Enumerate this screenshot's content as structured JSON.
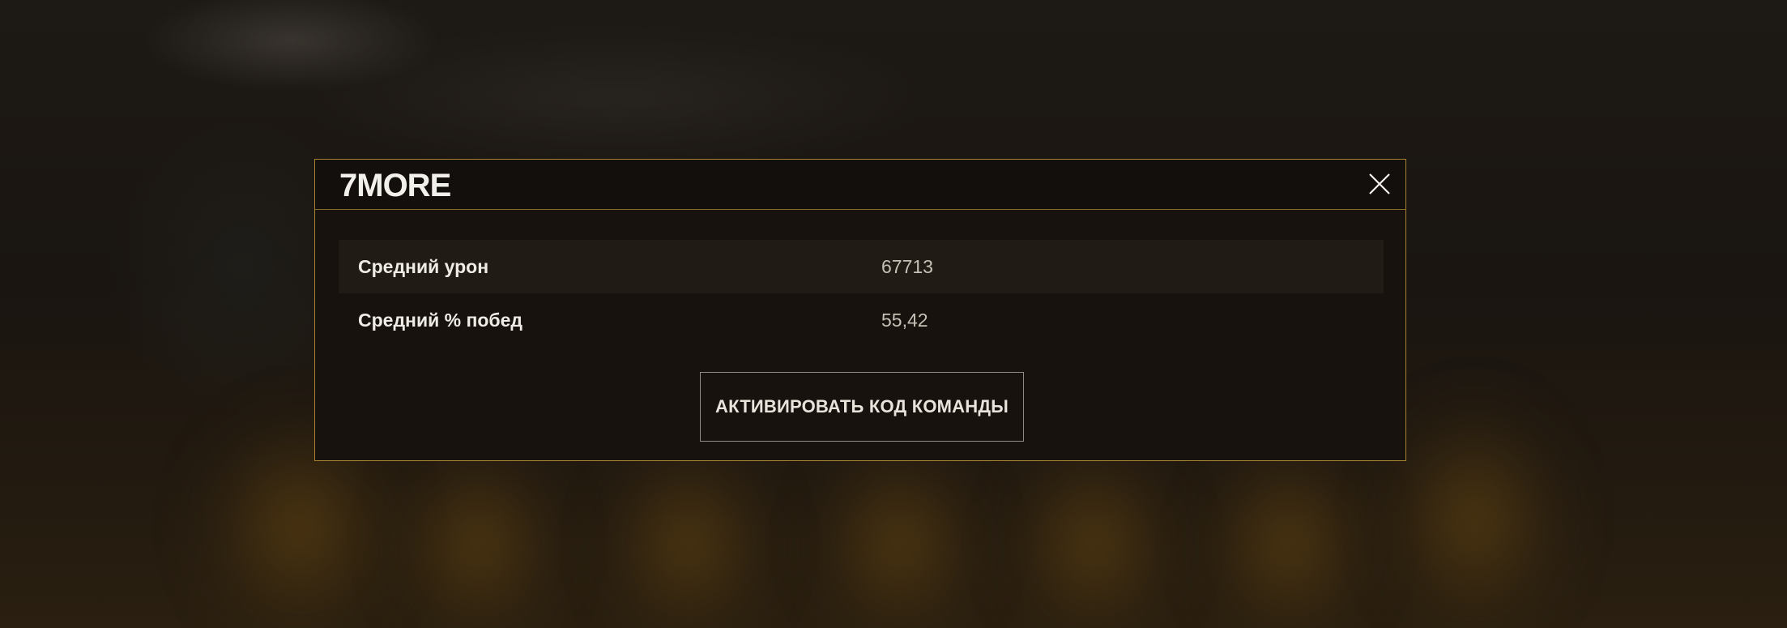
{
  "dialog": {
    "title": "7MORE",
    "close_icon": "close-icon",
    "stats": [
      {
        "label": "Средний урон",
        "value": "67713"
      },
      {
        "label": "Средний % побед",
        "value": "55,42"
      }
    ],
    "activate_button_label": "АКТИВИРОВАТЬ КОД КОМАНДЫ"
  },
  "colors": {
    "border_accent": "#a8822f",
    "dialog_background": "#17120e",
    "text_primary": "#efece6",
    "text_secondary": "#c6c0b6"
  }
}
